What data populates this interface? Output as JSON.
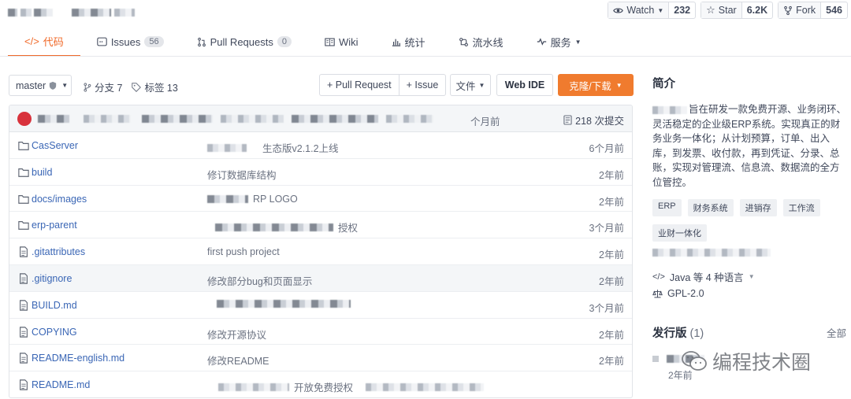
{
  "top": {
    "watch_label": "Watch",
    "watch_count": "232",
    "star_label": "Star",
    "star_count": "6.2K",
    "fork_label": "Fork",
    "fork_count": "546"
  },
  "tabs": [
    {
      "label": "代码",
      "icon": "code-icon"
    },
    {
      "label": "Issues",
      "count": "56",
      "icon": "issues-icon"
    },
    {
      "label": "Pull Requests",
      "count": "0",
      "icon": "pull-request-icon"
    },
    {
      "label": "Wiki",
      "icon": "wiki-icon"
    },
    {
      "label": "统计",
      "icon": "stats-icon"
    },
    {
      "label": "流水线",
      "icon": "pipeline-icon"
    },
    {
      "label": "服务",
      "icon": "service-icon"
    }
  ],
  "toolbar": {
    "branch": "master",
    "branches": "分支 7",
    "tags": "标签 13",
    "new_pr": "+ Pull Request",
    "new_issue": "+ Issue",
    "file": "文件",
    "web_ide": "Web IDE",
    "clone": "克隆/下载"
  },
  "commit": {
    "time": "个月前",
    "count": "218 次提交"
  },
  "files": [
    {
      "type": "folder",
      "name": "CasServer",
      "message": "生态版v2.1.2上线",
      "time": "6个月前"
    },
    {
      "type": "folder",
      "name": "build",
      "message": "修订数据库结构",
      "time": "2年前"
    },
    {
      "type": "folder",
      "name": "docs/images",
      "message": "RP LOGO",
      "time": "2年前"
    },
    {
      "type": "folder",
      "name": "erp-parent",
      "message": "授权",
      "time": "3个月前"
    },
    {
      "type": "file",
      "name": ".gitattributes",
      "message": "first push project",
      "time": "2年前"
    },
    {
      "type": "file",
      "name": ".gitignore",
      "message": "修改部分bug和页面显示",
      "time": "2年前"
    },
    {
      "type": "file",
      "name": "BUILD.md",
      "message": "",
      "time": "3个月前"
    },
    {
      "type": "file",
      "name": "COPYING",
      "message": "修改开源协议",
      "time": "2年前"
    },
    {
      "type": "file",
      "name": "README-english.md",
      "message": "修改README",
      "time": "2年前"
    },
    {
      "type": "file",
      "name": "README.md",
      "message": "开放免费授权",
      "time": ""
    }
  ],
  "sidebar": {
    "intro_title": "简介",
    "description": "旨在研发一款免费开源、业务闭环、灵活稳定的企业级ERP系统。实现真正的财务业务一体化；从计划预算，订单、出入库，到发票、收付款，再到凭证、分录、总账，实现对管理流、信息流、数据流的全方位管控。",
    "tags": [
      "ERP",
      "财务系统",
      "进销存",
      "工作流",
      "业财一体化"
    ],
    "language": "Java 等 4 种语言",
    "license": "GPL-2.0",
    "releases_title": "发行版",
    "releases_count": "(1)",
    "releases_all": "全部",
    "release_time": "2年前"
  },
  "watermark": "编程技术圈"
}
